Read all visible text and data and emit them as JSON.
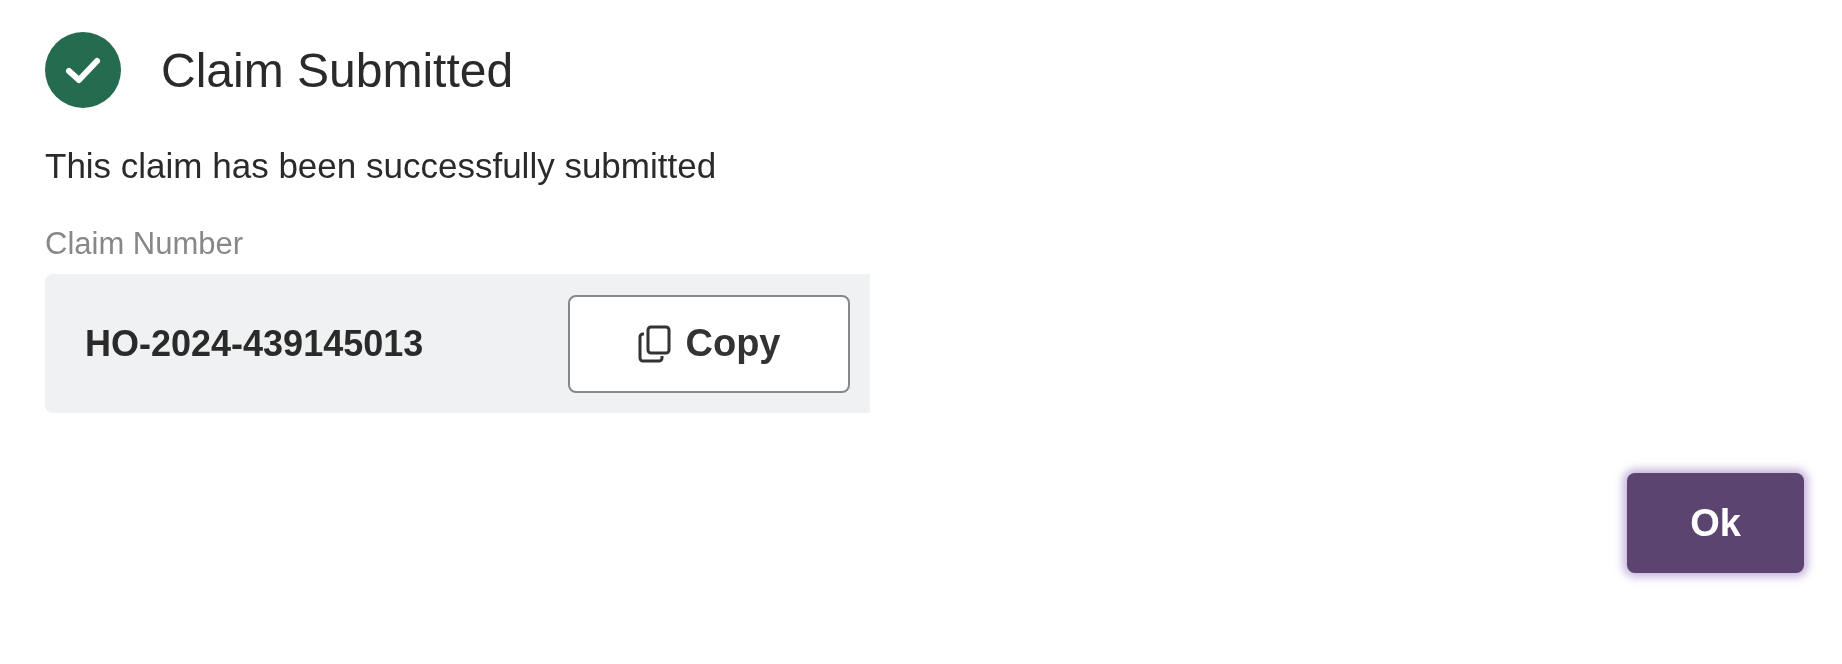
{
  "dialog": {
    "title": "Claim Submitted",
    "message": "This claim has been successfully submitted",
    "claim_number": {
      "label": "Claim Number",
      "value": "HO-2024-439145013",
      "copy_button": "Copy"
    },
    "buttons": [
      "Ok"
    ]
  }
}
